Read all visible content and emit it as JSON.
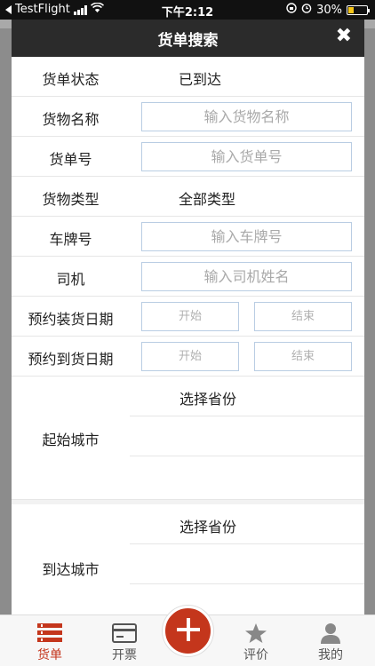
{
  "status_bar": {
    "app": "TestFlight",
    "time": "下午2:12",
    "battery": "30%",
    "battery_level": 0.3
  },
  "modal": {
    "title": "货单搜索",
    "close_icon": "close-icon"
  },
  "form": {
    "status": {
      "label": "货单状态",
      "value": "已到达"
    },
    "goods_name": {
      "label": "货物名称",
      "placeholder": "输入货物名称",
      "value": ""
    },
    "order_no": {
      "label": "货单号",
      "placeholder": "输入货单号",
      "value": ""
    },
    "goods_type": {
      "label": "货物类型",
      "value": "全部类型"
    },
    "plate": {
      "label": "车牌号",
      "placeholder": "输入车牌号",
      "value": ""
    },
    "driver": {
      "label": "司机",
      "placeholder": "输入司机姓名",
      "value": ""
    },
    "load_date": {
      "label": "预约装货日期",
      "start_placeholder": "开始",
      "end_placeholder": "结束"
    },
    "arrive_date": {
      "label": "预约到货日期",
      "start_placeholder": "开始",
      "end_placeholder": "结束"
    },
    "origin_city": {
      "label": "起始城市",
      "province": "选择省份"
    },
    "dest_city": {
      "label": "到达城市",
      "province": "选择省份"
    }
  },
  "tabbar": {
    "items": [
      {
        "label": "货单",
        "icon": "list-icon",
        "active": true
      },
      {
        "label": "开票",
        "icon": "card-icon",
        "active": false
      },
      {
        "label": "",
        "icon": "plus-icon",
        "active": false
      },
      {
        "label": "评价",
        "icon": "star-icon",
        "active": false
      },
      {
        "label": "我的",
        "icon": "user-icon",
        "active": false
      }
    ]
  },
  "colors": {
    "accent": "#c4361c",
    "header": "#2b2b2b",
    "input_border": "#b9cde3"
  }
}
